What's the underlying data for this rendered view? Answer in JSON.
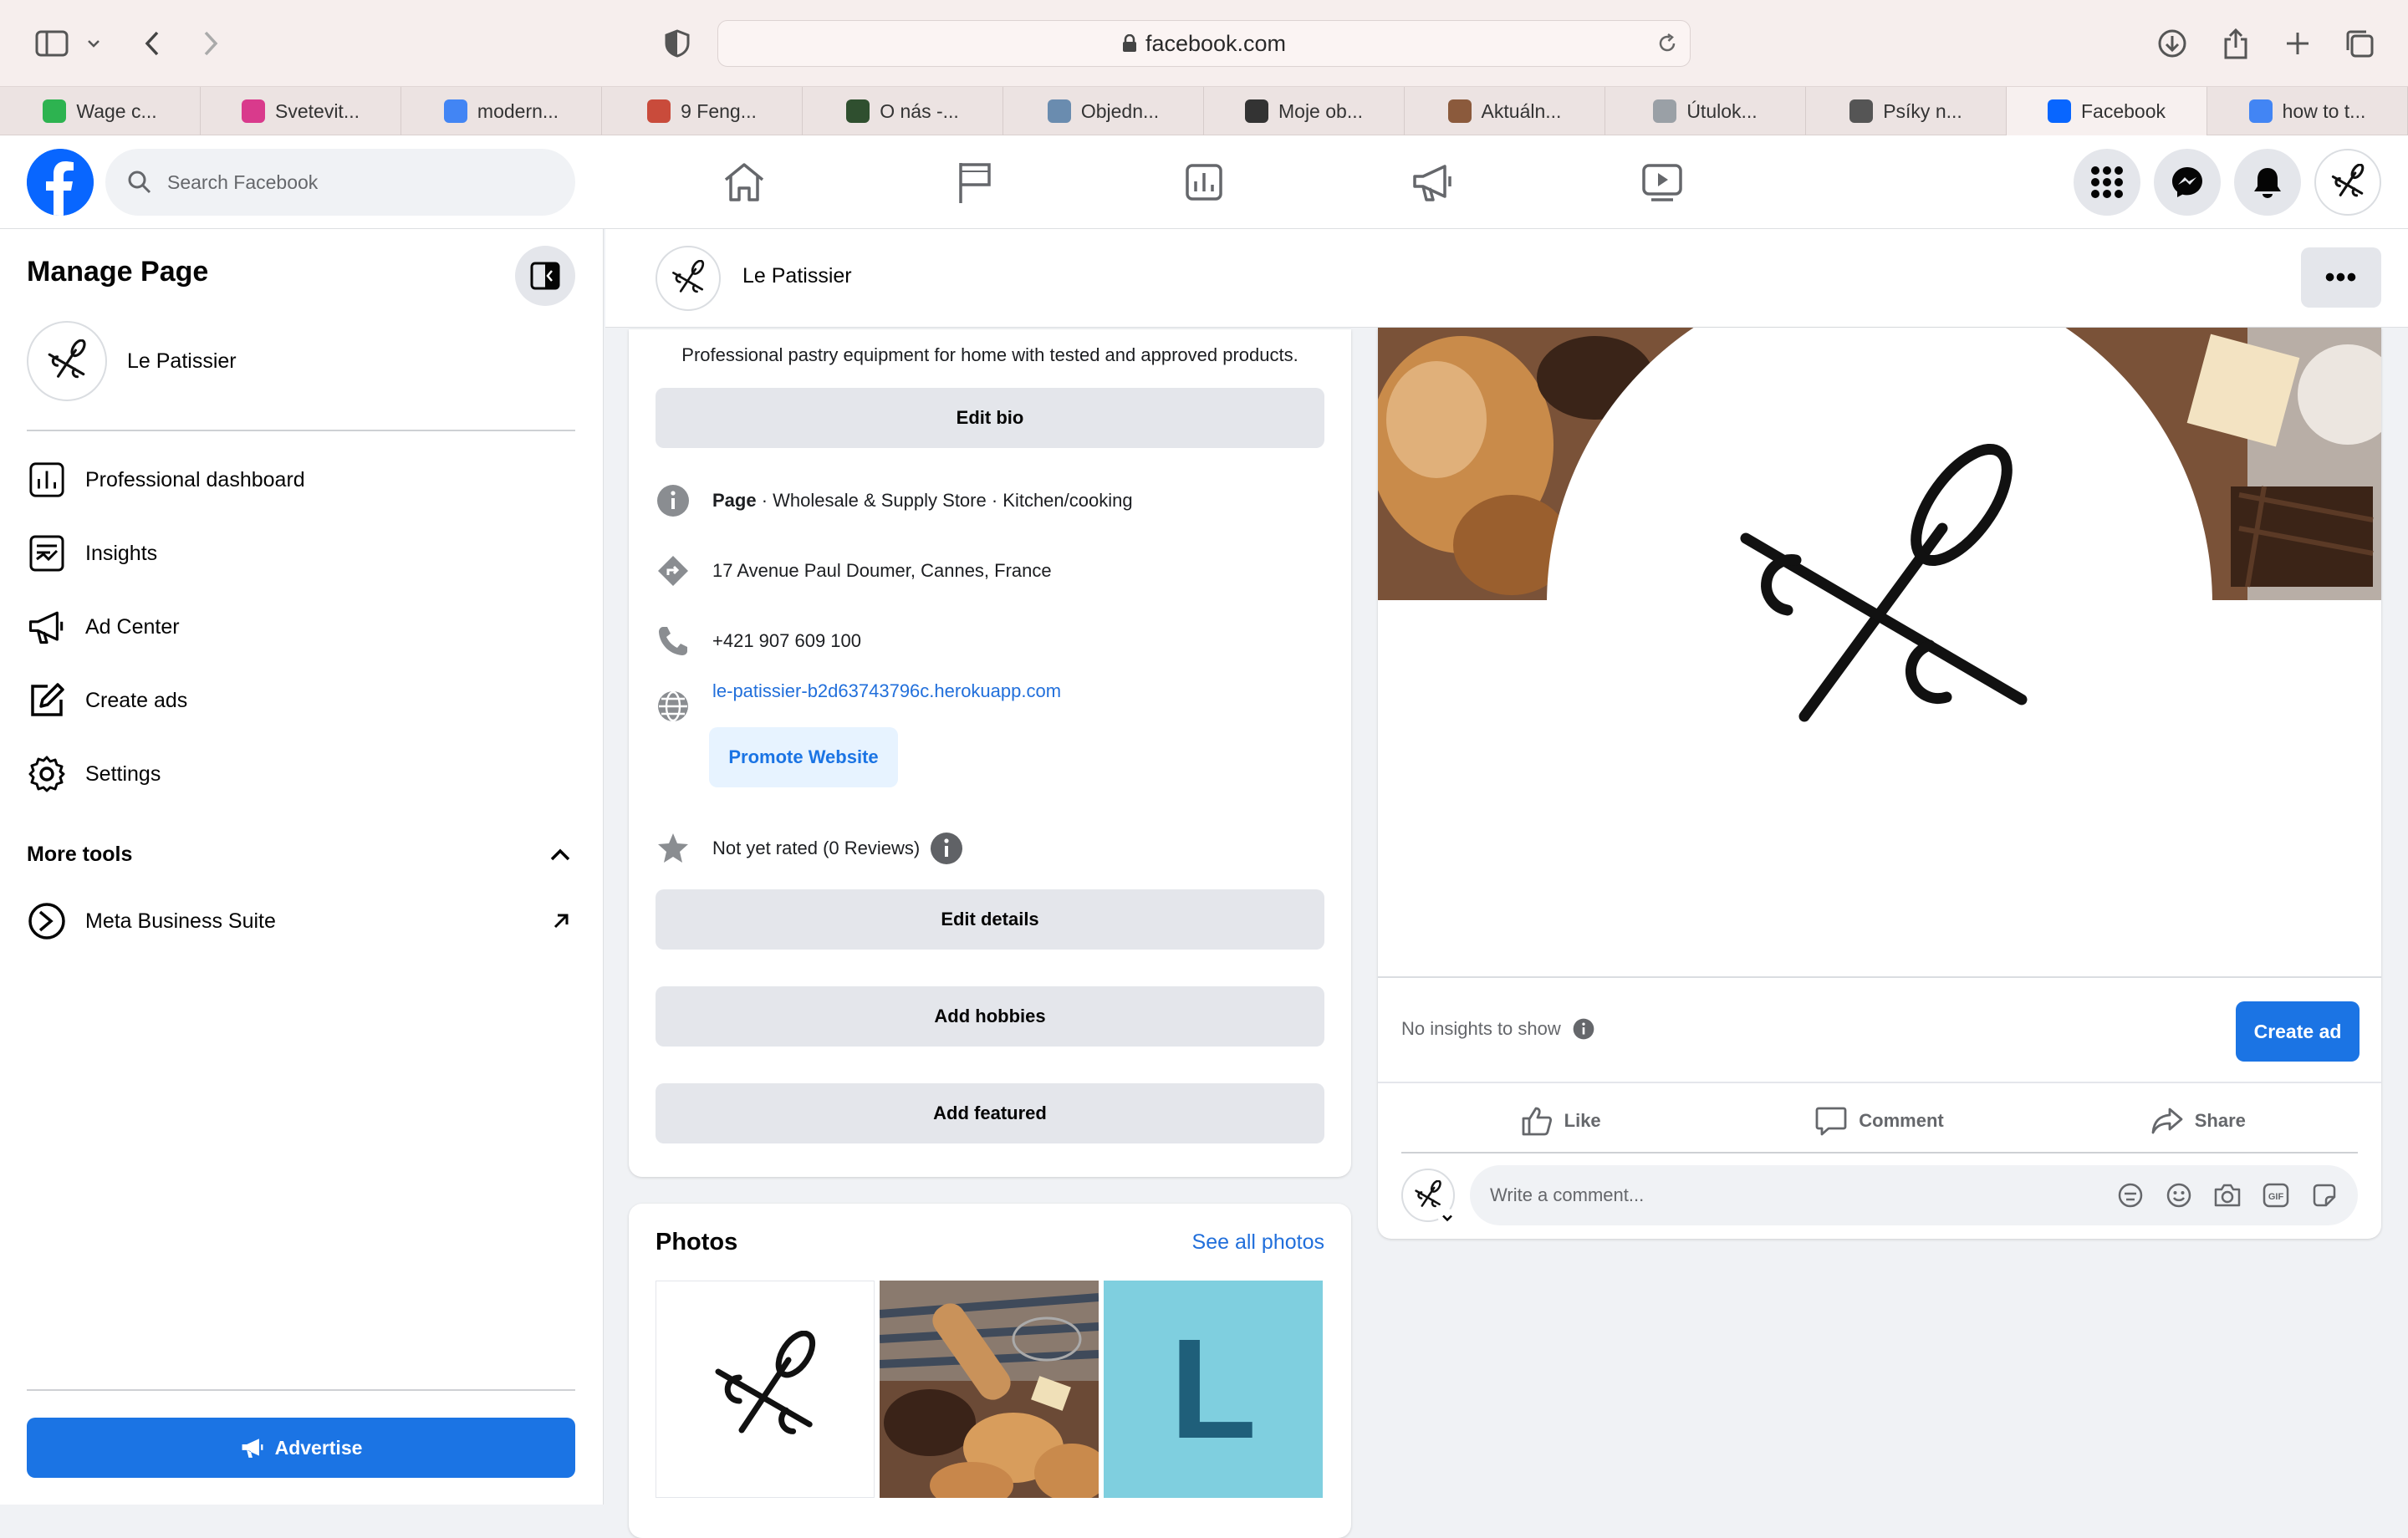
{
  "browser": {
    "url": "facebook.com",
    "tabs": [
      {
        "label": "Wage c...",
        "favicon_color": "#2db350"
      },
      {
        "label": "Svetevit...",
        "favicon_color": "#d93a8c"
      },
      {
        "label": "modern...",
        "favicon_color": "#4285f4"
      },
      {
        "label": "9 Feng...",
        "favicon_color": "#c94b3b"
      },
      {
        "label": "O nás -...",
        "favicon_color": "#2f4f2f"
      },
      {
        "label": "Objedn...",
        "favicon_color": "#6a8caf"
      },
      {
        "label": "Moje ob...",
        "favicon_color": "#333333"
      },
      {
        "label": "Aktuáln...",
        "favicon_color": "#8b5a3c"
      },
      {
        "label": "Útulok...",
        "favicon_color": "#9aa0a6"
      },
      {
        "label": "Psíky n...",
        "favicon_color": "#555555"
      },
      {
        "label": "Facebook",
        "favicon_color": "#0866ff"
      },
      {
        "label": "how to t...",
        "favicon_color": "#4285f4"
      }
    ],
    "active_tab_index": 10
  },
  "fb": {
    "search_placeholder": "Search Facebook",
    "brand_color": "#0866ff",
    "nav_icons": [
      "home-icon",
      "flag-icon",
      "dashboard-icon",
      "megaphone-icon",
      "video-icon"
    ]
  },
  "sidebar": {
    "title": "Manage Page",
    "page_name": "Le Patissier",
    "items": [
      {
        "label": "Professional dashboard",
        "icon": "dashboard-icon"
      },
      {
        "label": "Insights",
        "icon": "insights-icon"
      },
      {
        "label": "Ad Center",
        "icon": "megaphone-icon"
      },
      {
        "label": "Create ads",
        "icon": "edit-icon"
      },
      {
        "label": "Settings",
        "icon": "gear-icon"
      }
    ],
    "more_tools": "More tools",
    "tools": [
      {
        "label": "Meta Business Suite",
        "icon": "meta-icon"
      }
    ],
    "advertise": "Advertise"
  },
  "page_header": {
    "name": "Le Patissier",
    "more": "•••"
  },
  "intro": {
    "bio": "Professional pastry equipment for home with tested and approved products.",
    "edit_bio": "Edit bio",
    "category_label": "Page",
    "category": " · Wholesale & Supply Store · Kitchen/cooking",
    "address": "17 Avenue Paul Doumer, Cannes, France",
    "phone": "+421 907 609 100",
    "website": "le-patissier-b2d63743796c.herokuapp.com",
    "promote": "Promote Website",
    "rating": "Not yet rated (0 Reviews)",
    "edit_details": "Edit details",
    "add_hobbies": "Add hobbies",
    "add_featured": "Add featured"
  },
  "photos": {
    "title": "Photos",
    "see_all": "See all photos",
    "letter_tile": "L"
  },
  "post": {
    "no_insights": "No insights to show",
    "create_ad": "Create ad",
    "like": "Like",
    "comment": "Comment",
    "share": "Share",
    "comment_placeholder": "Write a comment..."
  }
}
